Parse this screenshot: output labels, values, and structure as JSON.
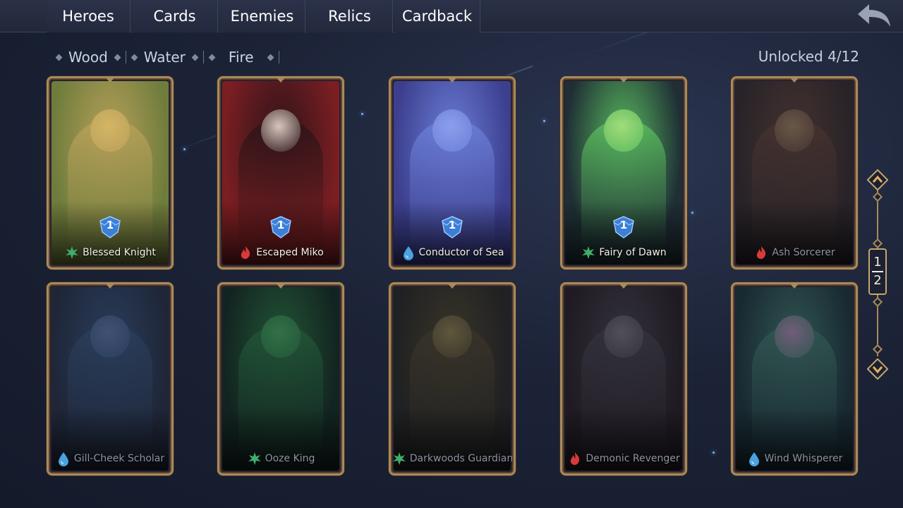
{
  "tabs": [
    {
      "label": "Heroes",
      "active": true
    },
    {
      "label": "Cards",
      "active": false
    },
    {
      "label": "Enemies",
      "active": false
    },
    {
      "label": "Relics",
      "active": false
    },
    {
      "label": "Cardback",
      "active": false
    }
  ],
  "back_icon": "back-arrow-icon",
  "filters": [
    "Wood",
    "Water",
    "Fire"
  ],
  "unlocked_label": "Unlocked 4/12",
  "colors": {
    "accent_gold": "#e3b15e",
    "frame_gold": "#a98a5f",
    "wood": "#3fae6b",
    "water": "#4aa3e0",
    "fire": "#d83a3a",
    "level_badge": "#3b7fd6"
  },
  "heroes": [
    {
      "name": "Blessed Knight",
      "element": "wood",
      "level": "1",
      "unlocked": true
    },
    {
      "name": "Escaped Miko",
      "element": "fire",
      "level": "1",
      "unlocked": true
    },
    {
      "name": "Conductor of Sea",
      "element": "water",
      "level": "1",
      "unlocked": true
    },
    {
      "name": "Fairy of Dawn",
      "element": "wood",
      "level": "1",
      "unlocked": true
    },
    {
      "name": "Ash Sorcerer",
      "element": "fire",
      "unlocked": false
    },
    {
      "name": "Gill-Cheek Scholar",
      "element": "water",
      "unlocked": false
    },
    {
      "name": "Ooze King",
      "element": "wood",
      "unlocked": false
    },
    {
      "name": "Darkwoods Guardian",
      "element": "wood",
      "unlocked": false
    },
    {
      "name": "Demonic Revenger",
      "element": "fire",
      "unlocked": false
    },
    {
      "name": "Wind Whisperer",
      "element": "water",
      "unlocked": false
    }
  ],
  "pager": {
    "current": "1",
    "total": "2"
  }
}
